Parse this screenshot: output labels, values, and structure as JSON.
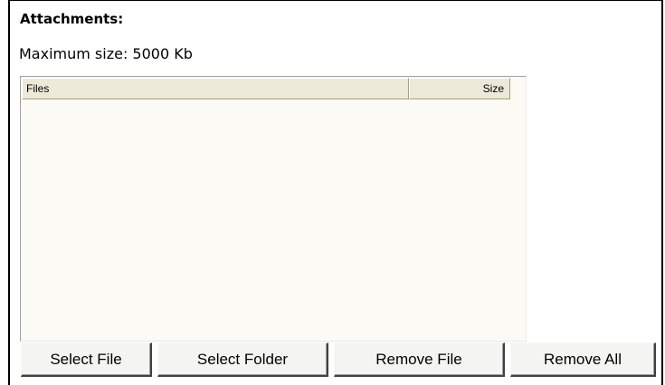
{
  "attachments": {
    "title": "Attachments:",
    "max_size_text": "Maximum size: 5000 Kb"
  },
  "file_list": {
    "columns": {
      "files": "Files",
      "size": "Size"
    },
    "rows": []
  },
  "buttons": {
    "select_file": "Select File",
    "select_folder": "Select Folder",
    "remove_file": "Remove File",
    "remove_all": "Remove All"
  }
}
